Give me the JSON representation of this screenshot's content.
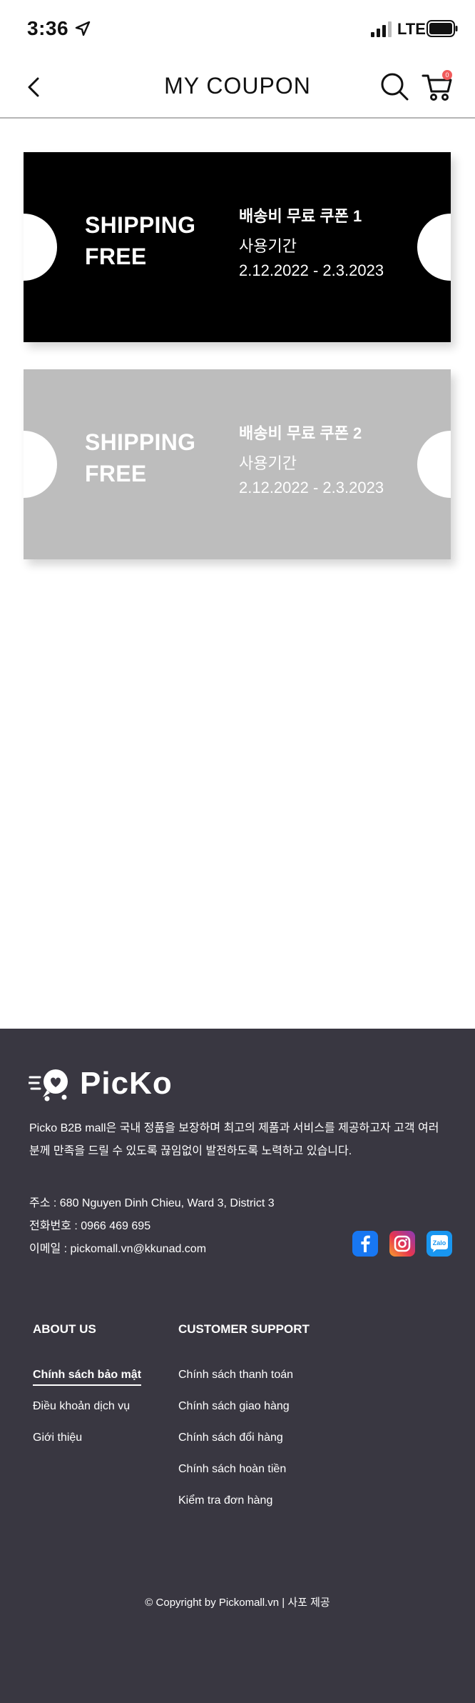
{
  "status_bar": {
    "time": "3:36",
    "network": "LTE"
  },
  "header": {
    "title": "MY COUPON",
    "cart_count": "0"
  },
  "coupons": [
    {
      "type": "SHIPPING\nFREE",
      "name": "배송비 무료 쿠폰 1",
      "period_label": "사용기간",
      "period": "2.12.2022 - 2.3.2023",
      "bg_color": "#000000",
      "state": "active"
    },
    {
      "type": "SHIPPING\nFREE",
      "name": "배송비 무료 쿠폰 2",
      "period_label": "사용기간",
      "period": "2.12.2022 - 2.3.2023",
      "bg_color": "#bdbdbd",
      "state": "inactive"
    }
  ],
  "footer": {
    "brand": "PicKo",
    "description": "Picko B2B mall은 국내 정품을 보장하며 최고의 제품과 서비스를 제공하고자 고객 여러분께 만족을 드릴 수 있도록 끊임없이 발전하도록 노력하고 있습니다.",
    "address": "주소 : 680 Nguyen Dinh Chieu, Ward 3, District 3",
    "phone": "전화번호 : 0966 469 695",
    "email": "이메일 : pickomall.vn@kkunad.com",
    "social": [
      {
        "name": "facebook",
        "icon": "facebook-icon"
      },
      {
        "name": "instagram",
        "icon": "instagram-icon"
      },
      {
        "name": "zalo",
        "icon": "zalo-icon",
        "label": "Zalo"
      }
    ],
    "about": {
      "heading": "ABOUT US",
      "links": [
        "Chính sách bảo mật",
        "Điều khoản dịch vụ",
        "Giới thiệu"
      ]
    },
    "support": {
      "heading": "CUSTOMER SUPPORT",
      "links": [
        "Chính sách thanh toán",
        "Chính sách giao hàng",
        "Chính sách đổi hàng",
        "Chính sách hoàn tiền",
        "Kiểm tra đơn hàng"
      ]
    },
    "copyright": "© Copyright by Pickomall.vn | 사포 제공"
  },
  "colors": {
    "footer_bg": "#393741",
    "badge": "#f15b5b",
    "divider": "#b5b5b5"
  }
}
